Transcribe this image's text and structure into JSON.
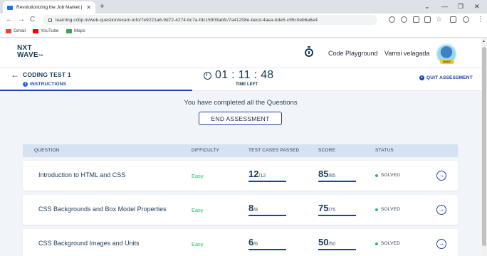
{
  "browser": {
    "tab_title": "Revolutionizing the Job Market | NxtWave",
    "tab_close": "✕",
    "new_tab": "+",
    "window_controls": [
      "⌄",
      "—",
      "❐",
      "✕"
    ],
    "url": "learning.ccbp.in/web-question/exam-info/7e9221a6-9d72-4274-bc7a-fdc15909abfc/7a41208e-becd-4aea-bde5-c95c0eb6a6e4",
    "nav": {
      "back": "←",
      "forward": "→",
      "reload": "C"
    },
    "bookmarks": [
      {
        "label": "Gmail",
        "icon": "gmail-icon",
        "color": "#ea4335"
      },
      {
        "label": "YouTube",
        "icon": "youtube-icon",
        "color": "#ff0000"
      },
      {
        "label": "Maps",
        "icon": "maps-icon",
        "color": "#34a853"
      }
    ]
  },
  "header": {
    "logo_line1": "NXT",
    "logo_line2": "WAVE",
    "logo_tm": "TM",
    "code_playground": "Code Playground",
    "user_name": "Vamsi velagada",
    "avatar_badge": "SMART"
  },
  "subheader": {
    "back": "←",
    "test_title": "CODING TEST 1",
    "instructions": "INSTRUCTIONS",
    "timer": "01 : 11 : 48",
    "time_left": "TIME LEFT",
    "quit": "QUIT ASSESSMENT",
    "info_glyph": "i",
    "quit_glyph": "●"
  },
  "main": {
    "completed_message": "You have completed all the Questions",
    "end_button": "END ASSESSMENT",
    "columns": [
      "QUESTION",
      "DIFFICULTY",
      "TEST CASES PASSED",
      "SCORE",
      "STATUS"
    ],
    "rows": [
      {
        "question": "Introduction to HTML and CSS",
        "difficulty": "Easy",
        "tests_passed": "12",
        "tests_total": "/12",
        "tests_fraction": 1.0,
        "score": "85",
        "score_total": "/85",
        "score_fraction": 1.0,
        "status": "SOLVED",
        "action": "→"
      },
      {
        "question": "CSS Backgrounds and Box Model Properties",
        "difficulty": "Easy",
        "tests_passed": "8",
        "tests_total": "/8",
        "tests_fraction": 1.0,
        "score": "75",
        "score_total": "/75",
        "score_fraction": 1.0,
        "status": "SOLVED",
        "action": "→"
      },
      {
        "question": "CSS Background Images and Units",
        "difficulty": "Easy",
        "tests_passed": "6",
        "tests_total": "/6",
        "tests_fraction": 1.0,
        "score": "50",
        "score_total": "/50",
        "score_fraction": 1.0,
        "status": "SOLVED",
        "action": "→"
      }
    ]
  },
  "colors": {
    "accent": "#1e40af",
    "easy": "#22c55e",
    "solved_dot": "#22c55e",
    "header_bg": "#d6e2f1"
  }
}
